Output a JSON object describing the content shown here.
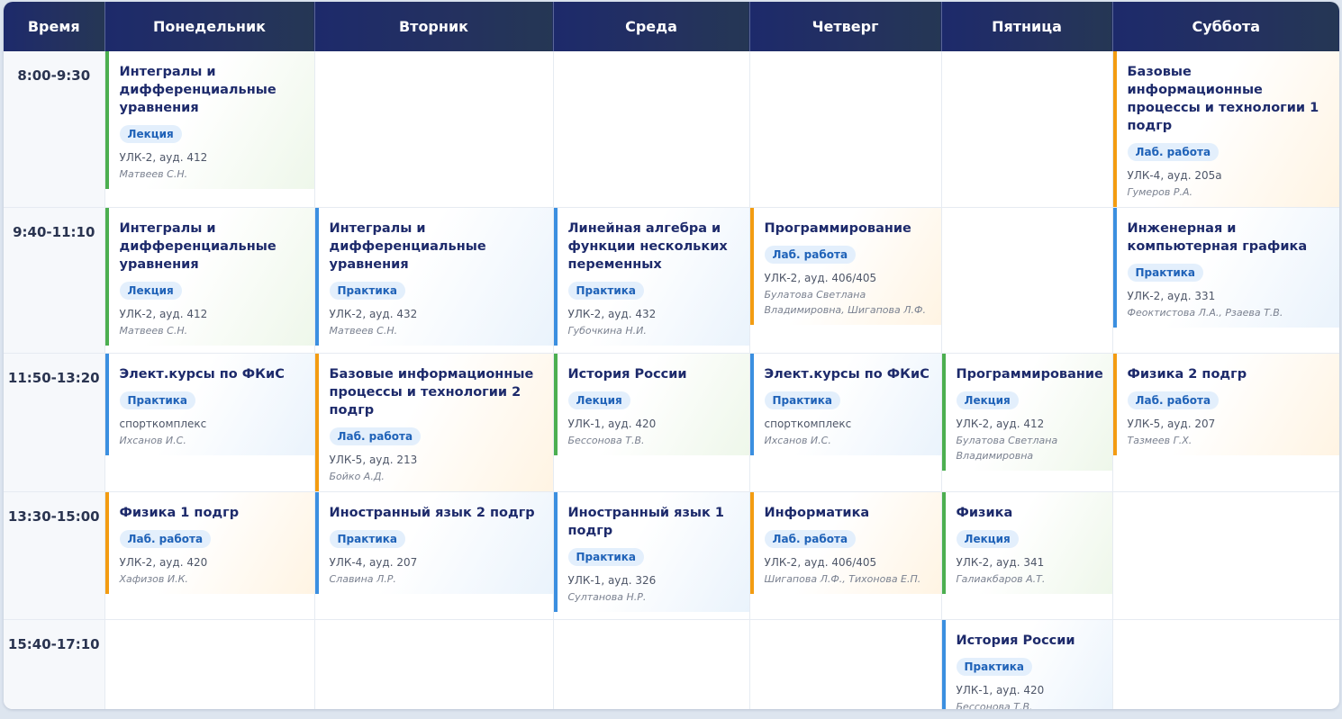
{
  "header": {
    "time": "Время",
    "days": [
      "Понедельник",
      "Вторник",
      "Среда",
      "Четверг",
      "Пятница",
      "Суббота"
    ]
  },
  "colors": {
    "lecture": "#4caf50",
    "practice": "#3b8fe0",
    "lab": "#f39c12",
    "header": "#1d2a6b"
  },
  "slots": [
    {
      "time": "8:00-9:30",
      "cells": [
        {
          "subject": "Интегралы и дифференциальные уравнения",
          "type": "Лекция",
          "color": "green",
          "room": "УЛК-2, ауд. 412",
          "teacher": "Матвеев С.Н."
        },
        null,
        null,
        null,
        null,
        {
          "subject": "Базовые информационные процессы и технологии 1 подгр",
          "type": "Лаб. работа",
          "color": "orange",
          "room": "УЛК-4, ауд. 205а",
          "teacher": "Гумеров Р.А."
        }
      ]
    },
    {
      "time": "9:40-11:10",
      "cells": [
        {
          "subject": "Интегралы и дифференциальные уравнения",
          "type": "Лекция",
          "color": "green",
          "room": "УЛК-2, ауд. 412",
          "teacher": "Матвеев С.Н."
        },
        {
          "subject": "Интегралы и дифференциальные уравнения",
          "type": "Практика",
          "color": "blue",
          "room": "УЛК-2, ауд. 432",
          "teacher": "Матвеев С.Н."
        },
        {
          "subject": "Линейная алгебра и функции нескольких переменных",
          "type": "Практика",
          "color": "blue",
          "room": "УЛК-2, ауд. 432",
          "teacher": "Губочкина Н.И."
        },
        {
          "subject": "Программирование",
          "type": "Лаб. работа",
          "color": "orange",
          "room": "УЛК-2, ауд. 406/405",
          "teacher": "Булатова Светлана Владимировна, Шигапова Л.Ф."
        },
        null,
        {
          "subject": "Инженерная и компьютерная графика",
          "type": "Практика",
          "color": "blue",
          "room": "УЛК-2, ауд. 331",
          "teacher": "Феоктистова Л.А., Рзаева Т.В."
        }
      ]
    },
    {
      "time": "11:50-13:20",
      "cells": [
        {
          "subject": "Элект.курсы по ФКиС",
          "type": "Практика",
          "color": "blue",
          "room": "спорткомплекс",
          "teacher": "Ихсанов И.С."
        },
        {
          "subject": "Базовые информационные процессы и технологии 2 подгр",
          "type": "Лаб. работа",
          "color": "orange",
          "room": "УЛК-5, ауд. 213",
          "teacher": "Бойко А.Д."
        },
        {
          "subject": "История России",
          "type": "Лекция",
          "color": "green",
          "room": "УЛК-1, ауд. 420",
          "teacher": "Бессонова Т.В."
        },
        {
          "subject": "Элект.курсы по ФКиС",
          "type": "Практика",
          "color": "blue",
          "room": "спорткомплекс",
          "teacher": "Ихсанов И.С."
        },
        {
          "subject": "Программирование",
          "type": "Лекция",
          "color": "green",
          "room": "УЛК-2, ауд. 412",
          "teacher": "Булатова Светлана Владимировна"
        },
        {
          "subject": "Физика 2 подгр",
          "type": "Лаб. работа",
          "color": "orange",
          "room": "УЛК-5, ауд. 207",
          "teacher": "Тазмеев Г.Х."
        }
      ]
    },
    {
      "time": "13:30-15:00",
      "cells": [
        {
          "subject": "Физика 1 подгр",
          "type": "Лаб. работа",
          "color": "orange",
          "room": "УЛК-2, ауд. 420",
          "teacher": "Хафизов И.К."
        },
        {
          "subject": "Иностранный язык 2 подгр",
          "type": "Практика",
          "color": "blue",
          "room": "УЛК-4, ауд. 207",
          "teacher": "Славина Л.Р."
        },
        {
          "subject": "Иностранный язык 1 подгр",
          "type": "Практика",
          "color": "blue",
          "room": "УЛК-1, ауд. 326",
          "teacher": "Султанова Н.Р."
        },
        {
          "subject": "Информатика",
          "type": "Лаб. работа",
          "color": "orange",
          "room": "УЛК-2, ауд. 406/405",
          "teacher": "Шигапова Л.Ф., Тихонова Е.П."
        },
        {
          "subject": "Физика",
          "type": "Лекция",
          "color": "green",
          "room": "УЛК-2, ауд. 341",
          "teacher": "Галиакбаров А.Т."
        },
        null
      ]
    },
    {
      "time": "15:40-17:10",
      "cells": [
        null,
        null,
        null,
        null,
        {
          "subject": "История России",
          "type": "Практика",
          "color": "blue",
          "room": "УЛК-1, ауд. 420",
          "teacher": "Бессонова Т.В."
        },
        null
      ]
    }
  ]
}
